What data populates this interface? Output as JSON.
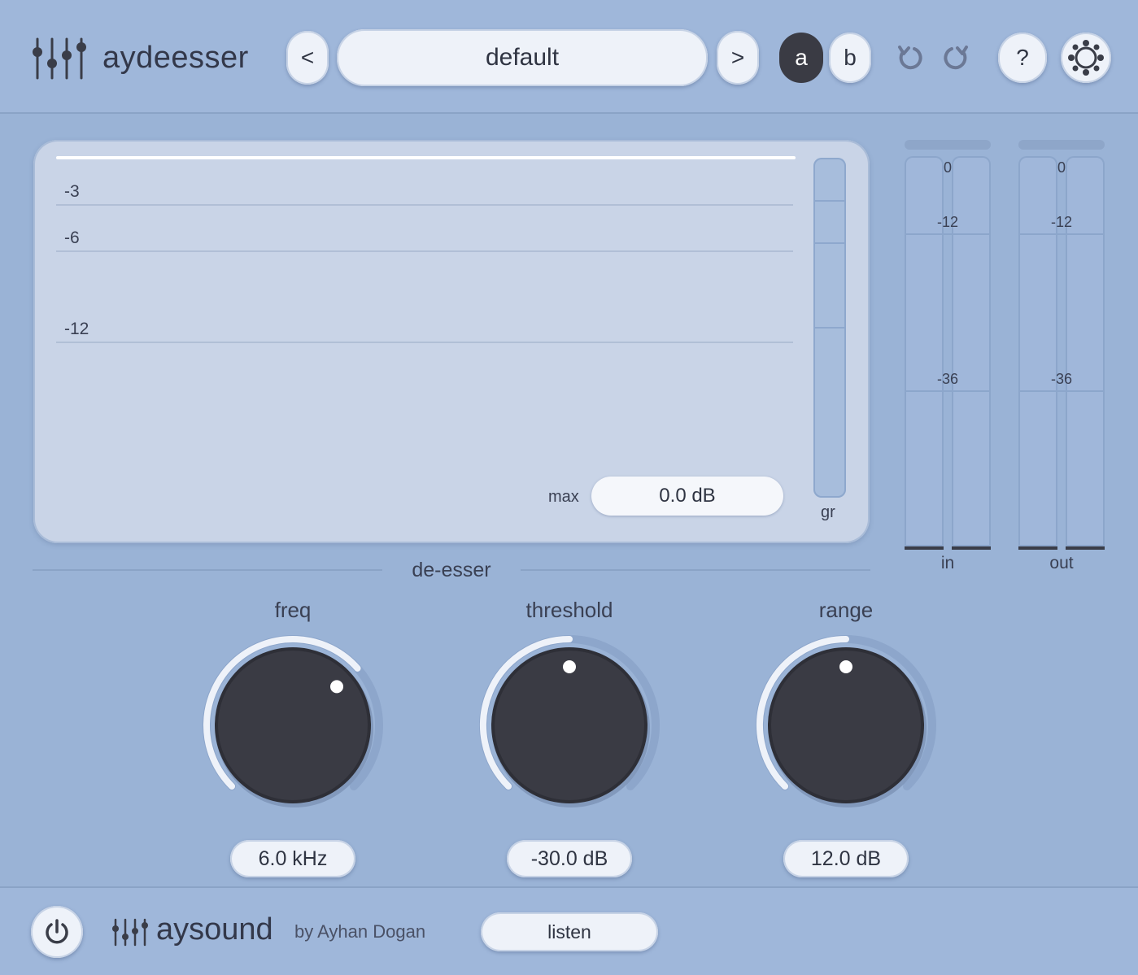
{
  "header": {
    "app_title": "aydeesser",
    "prev_label": "<",
    "preset_name": "default",
    "next_label": ">",
    "ab_a_label": "a",
    "ab_b_label": "b",
    "help_label": "?"
  },
  "display": {
    "grid_labels": [
      "-3",
      "-6",
      "-12"
    ],
    "max_label": "max",
    "max_value": "0.0 dB",
    "gr_label": "gr"
  },
  "meters": {
    "scale": [
      "0",
      "-12",
      "-36"
    ],
    "in_label": "in",
    "out_label": "out"
  },
  "section": {
    "title": "de-esser"
  },
  "knobs": [
    {
      "label": "freq",
      "value": "6.0 kHz",
      "position": 0.68
    },
    {
      "label": "threshold",
      "value": "-30.0 dB",
      "position": 0.5
    },
    {
      "label": "range",
      "value": "12.0 dB",
      "position": 0.5
    }
  ],
  "footer": {
    "brand": "aysound",
    "byline": "by Ayhan Dogan",
    "listen_label": "listen"
  },
  "colors": {
    "background": "#9ab3d6",
    "panel": "#c9d4e7",
    "knob": "#3a3b44",
    "arc": "#eef2f9",
    "ab_active": "#3a3b44"
  }
}
